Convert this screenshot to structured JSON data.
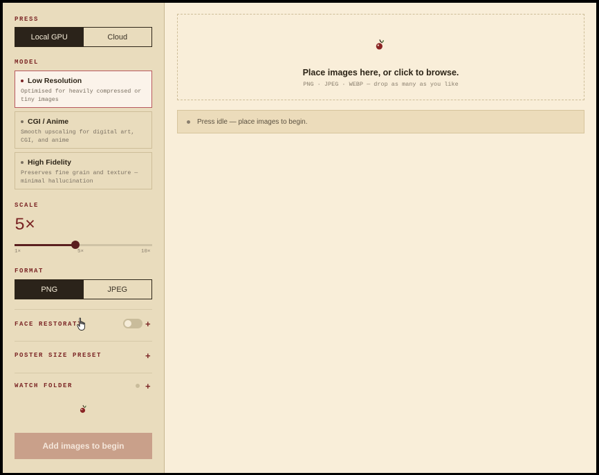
{
  "sidebar": {
    "press": {
      "label": "PRESS",
      "options": [
        "Local GPU",
        "Cloud"
      ],
      "selected": "Local GPU"
    },
    "model": {
      "label": "MODEL",
      "options": [
        {
          "title": "Low Resolution",
          "desc1": "Optimised for heavily compressed or",
          "desc2": "tiny images",
          "selected": true
        },
        {
          "title": "CGI / Anime",
          "desc1": "Smooth upscaling for digital art,",
          "desc2": "CGI, and anime",
          "selected": false
        },
        {
          "title": "High Fidelity",
          "desc1": "Preserves fine grain and texture —",
          "desc2": "minimal hallucination",
          "selected": false
        }
      ]
    },
    "scale": {
      "label": "SCALE",
      "value": "5×",
      "numeric_value": 5,
      "min": 1,
      "max": 10,
      "ticks": [
        "1×",
        "5×",
        "10×"
      ]
    },
    "format": {
      "label": "FORMAT",
      "options": [
        "PNG",
        "JPEG"
      ],
      "selected": "PNG"
    },
    "face_restoration": {
      "label": "FACE RESTORATI",
      "enabled": false,
      "expand": "+"
    },
    "poster_size_preset": {
      "label": "POSTER SIZE PRESET",
      "expand": "+"
    },
    "watch_folder": {
      "label": "WATCH FOLDER",
      "expand": "+"
    },
    "cta_label": "Add images to begin"
  },
  "main": {
    "dropzone": {
      "icon": "cherry-icon",
      "title": "Place images here, or click to browse.",
      "subtitle": "PNG · JPEG · WEBP — drop as many as you like"
    },
    "status": {
      "text": "Press idle — place images to begin."
    }
  },
  "colors": {
    "accent": "#7a2424",
    "sidebar_bg": "#e9dcbd",
    "main_bg": "#f9eed9",
    "dark": "#2b231a",
    "cta_bg": "#c9a08a"
  }
}
